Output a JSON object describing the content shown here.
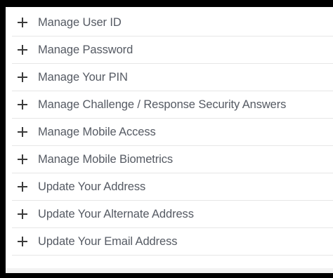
{
  "settings": {
    "items": [
      {
        "label": "Manage User ID",
        "icon": "plus-icon"
      },
      {
        "label": "Manage Password",
        "icon": "plus-icon"
      },
      {
        "label": "Manage Your PIN",
        "icon": "plus-icon"
      },
      {
        "label": "Manage Challenge / Response Security Answers",
        "icon": "plus-icon"
      },
      {
        "label": "Manage Mobile Access",
        "icon": "plus-icon"
      },
      {
        "label": "Manage Mobile Biometrics",
        "icon": "plus-icon"
      },
      {
        "label": "Update Your Address",
        "icon": "plus-icon"
      },
      {
        "label": "Update Your Alternate Address",
        "icon": "plus-icon"
      },
      {
        "label": "Update Your Email Address",
        "icon": "plus-icon"
      }
    ]
  },
  "colors": {
    "frame": "#000000",
    "panel": "#ffffff",
    "text": "#555a63",
    "icon": "#3b3b3b",
    "divider": "#e6e6e6"
  }
}
